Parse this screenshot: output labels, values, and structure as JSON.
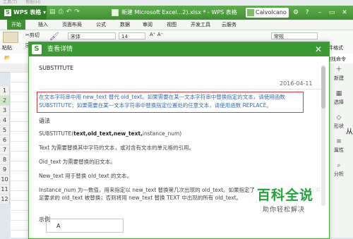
{
  "top_strip": [
    "工具(T)",
    "帮助(H)"
  ],
  "app": {
    "name": "WPS 表格",
    "logo_letter": "S",
    "document_title": "新建 Microsoft Excel...2).xlsx * - WPS 表格",
    "user_name": "Caivolcano",
    "window_controls": [
      "⚙",
      "?",
      "–",
      "▭",
      "✕"
    ]
  },
  "menu_tabs": [
    "开始",
    "插入",
    "页面布局",
    "公式",
    "数据",
    "审阅",
    "视图",
    "开发工具",
    "云服务"
  ],
  "ribbon": {
    "paste": "粘贴",
    "cut": "剪切",
    "copy": "复制",
    "font_name": "宋体",
    "font_size": "14",
    "number_format": "常规",
    "conditional_format": "条件格式"
  },
  "formula_bar": {
    "search_function": "查找命令"
  },
  "sheet": {
    "row_numbers": [
      "1",
      "2",
      "3",
      "4",
      "5",
      "6",
      "7",
      "8",
      "9",
      "10",
      "11",
      "12"
    ],
    "selected_row": "2"
  },
  "right_pane": {
    "items": [
      "新建",
      "选择",
      "形状",
      "属性",
      "分析"
    ],
    "cell_text": "从"
  },
  "dialog": {
    "title": "查看详情",
    "function_name": "SUBSTITUTE",
    "date": "2016-04-11",
    "highlight_text": "在文本字符串中用 new_text 替代 old_text。如果需要在某一文本字符串中替换指定的文本，请使用函数 SUBSTITUTE；如果需要在某一文本字符串中替换指定位置处的任意文本，请使用函数 REPLACE。",
    "syntax_heading": "语法",
    "syntax_fn": "SUBSTITUTE(",
    "syntax_bold": "text,old_text,new_text,",
    "syntax_rest": "instance_num)",
    "param_text": "Text   为需要替换其中字符的文本，或对含有文本的单元格的引用。",
    "param_old": "Old_text   为需要替换的旧文本。",
    "param_new": "New_text   用于替换 old_text 的文本。",
    "param_instance": "Instance_num   为一数值，用来指定以 new_text 替换第几次出现的 old_text。如果指定了 instance_num，则只有满足要求的 old_text 被替换；否则将用 new_text 替换 TEXT 中出现的所有 old_text。",
    "example_heading": "示例",
    "example_cell": "A",
    "close_icon": "✕"
  },
  "watermark": {
    "line1": "百科全说",
    "line2": "助你轻松解决"
  },
  "colors": {
    "wps_green": "#3f8f33",
    "highlight_border": "#e03a3a",
    "highlight_text": "#3a6bb0"
  }
}
